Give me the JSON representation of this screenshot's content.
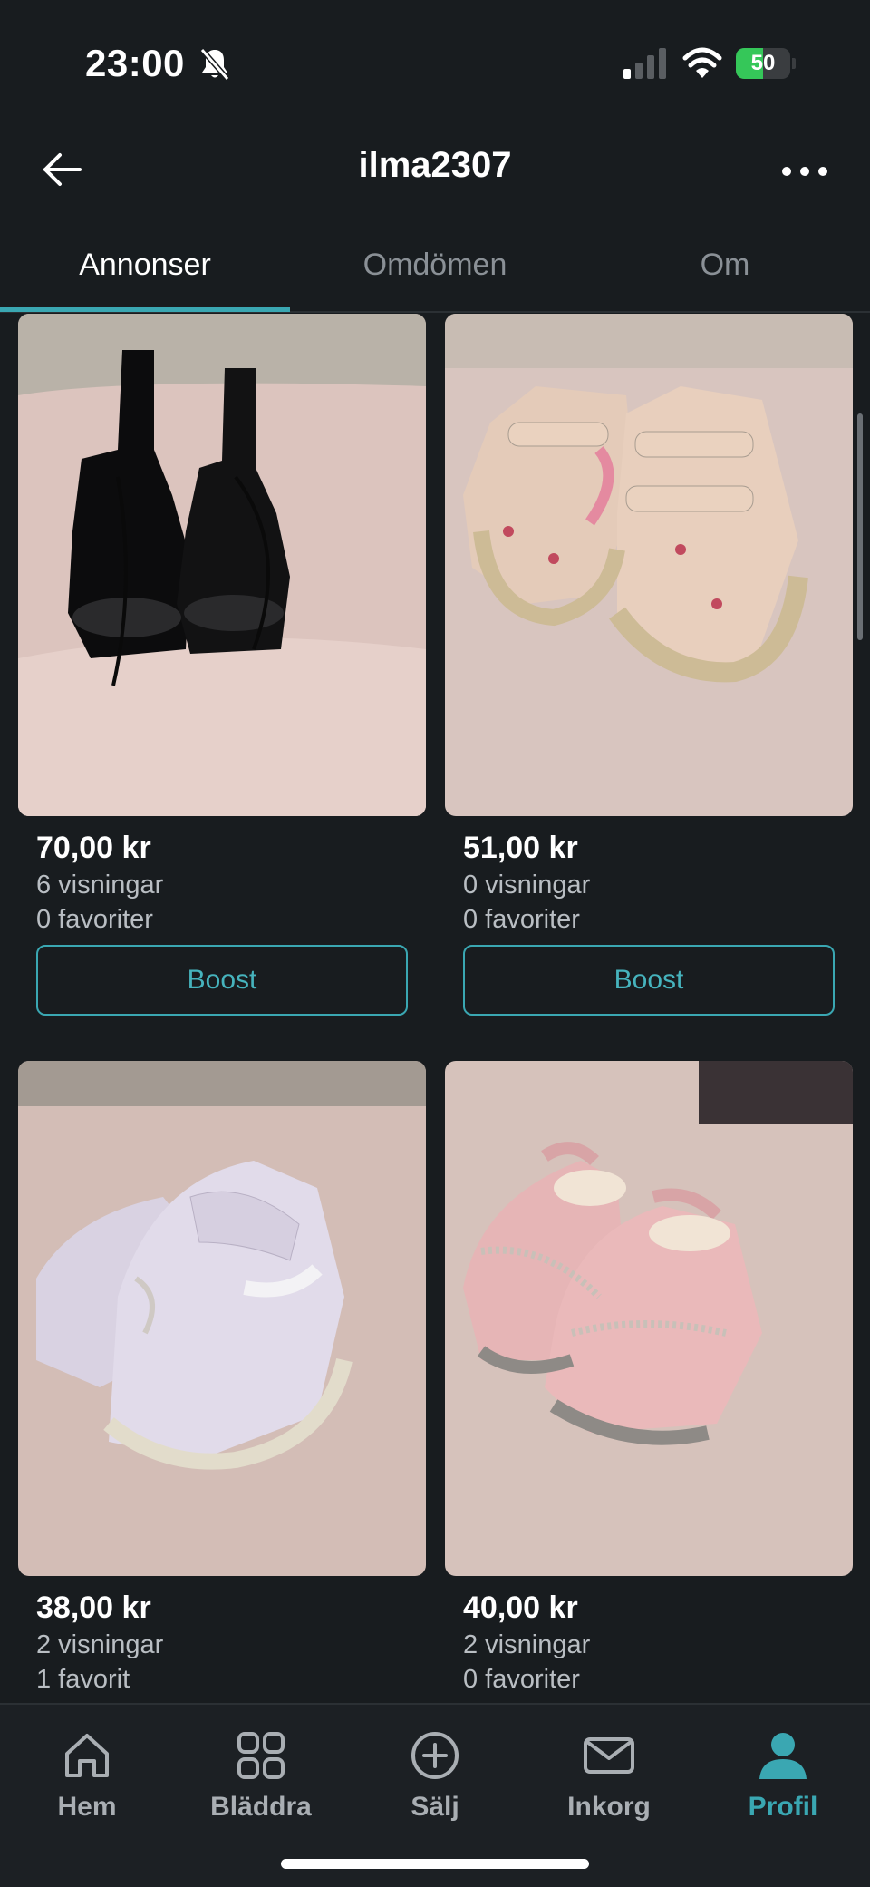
{
  "status_bar": {
    "time": "23:00",
    "battery_percent": "50",
    "icons": [
      "bell-slash-icon",
      "signal-icon",
      "wifi-icon",
      "battery-charging-icon"
    ]
  },
  "header": {
    "title": "ilma2307",
    "back_icon": "arrow-left-icon",
    "more_icon": "more-horizontal-icon"
  },
  "tabs": [
    {
      "label": "Annonser",
      "active": true
    },
    {
      "label": "Omdömen",
      "active": false
    },
    {
      "label": "Om",
      "active": false
    }
  ],
  "listings": [
    {
      "price": "70,00 kr",
      "views": "6 visningar",
      "favorites": "0 favoriter",
      "boost_label": "Boost"
    },
    {
      "price": "51,00 kr",
      "views": "0 visningar",
      "favorites": "0 favoriter",
      "boost_label": "Boost"
    },
    {
      "price": "38,00 kr",
      "views": "2 visningar",
      "favorites": "1 favorit"
    },
    {
      "price": "40,00 kr",
      "views": "2 visningar",
      "favorites": "0 favoriter"
    }
  ],
  "bottom_nav": [
    {
      "label": "Hem",
      "icon": "home-icon",
      "active": false
    },
    {
      "label": "Bläddra",
      "icon": "grid-icon",
      "active": false
    },
    {
      "label": "Sälj",
      "icon": "plus-circle-icon",
      "active": false
    },
    {
      "label": "Inkorg",
      "icon": "mail-icon",
      "active": false
    },
    {
      "label": "Profil",
      "icon": "person-icon",
      "active": true
    }
  ],
  "colors": {
    "background": "#181c1f",
    "accent": "#3aa7b2",
    "muted_text": "#b9bec3",
    "battery_green": "#35c759"
  }
}
